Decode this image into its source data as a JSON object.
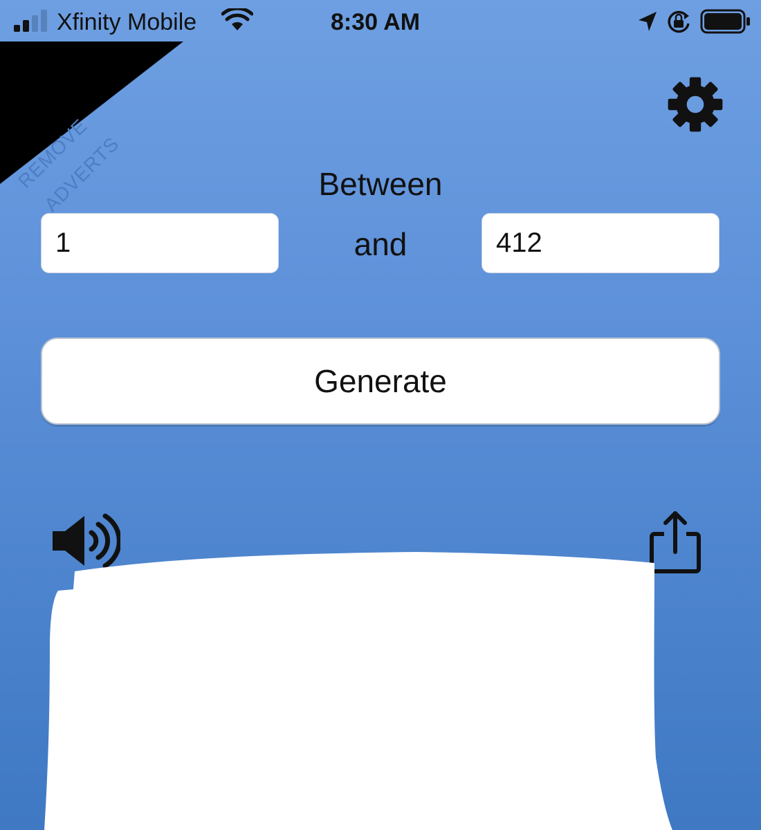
{
  "status_bar": {
    "carrier": "Xfinity Mobile",
    "time": "8:30 AM",
    "signal_bars_active": 2,
    "signal_bars_total": 4
  },
  "ad_banner": {
    "line1": "REMOVE",
    "line2": "ADVERTS"
  },
  "range": {
    "between_label": "Between",
    "and_label": "and",
    "min_value": "1",
    "max_value": "412"
  },
  "actions": {
    "generate_label": "Generate"
  },
  "icons": {
    "signal": "cellular-signal-icon",
    "wifi": "wifi-icon",
    "location": "location-arrow-icon",
    "rotation_lock": "rotation-lock-icon",
    "battery": "battery-icon",
    "settings": "gear-icon",
    "sound": "speaker-icon",
    "share": "share-icon"
  },
  "colors": {
    "background_top": "#6e9fe2",
    "background_bottom": "#3f78c3",
    "banner_bg": "#000000",
    "banner_text": "#4d7ec4",
    "field_bg": "#ffffff",
    "icon": "#111111"
  }
}
